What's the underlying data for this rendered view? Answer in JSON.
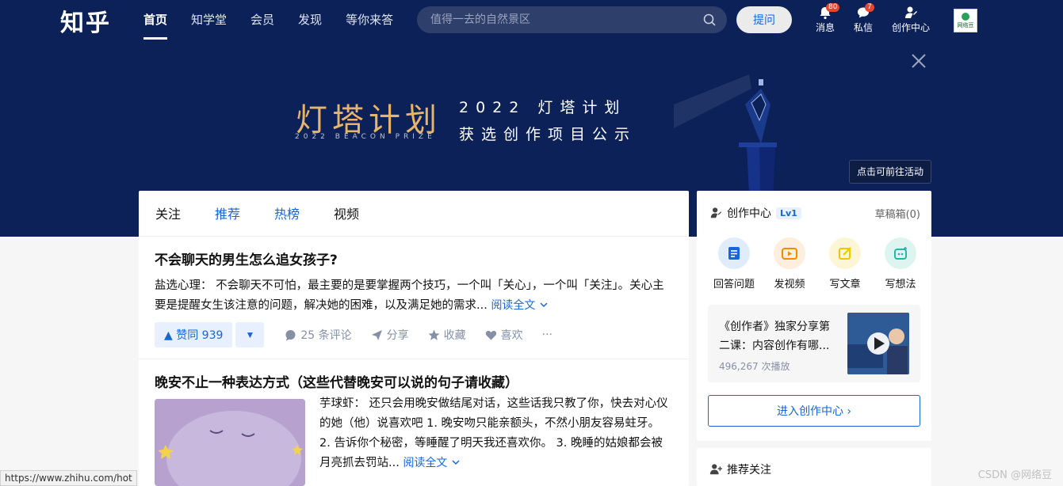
{
  "header": {
    "logo": "知乎",
    "nav": [
      "首页",
      "知学堂",
      "会员",
      "发现",
      "等你来答"
    ],
    "search_placeholder": "值得一去的自然景区",
    "ask_label": "提问",
    "icons": [
      {
        "label": "消息",
        "badge": "80",
        "icon": "bell-icon"
      },
      {
        "label": "私信",
        "badge": "7",
        "icon": "chat-bubble-icon"
      },
      {
        "label": "创作中心",
        "badge": "",
        "icon": "creator-icon"
      }
    ],
    "avatar_text": "网络豆"
  },
  "banner": {
    "title": "灯塔计划",
    "subtitle_en": "2022 BEACON PRIZE",
    "line1": "2022 灯塔计划",
    "line2": "获选创作项目公示",
    "cta": "点击可前往活动"
  },
  "feed": {
    "tabs": [
      "关注",
      "推荐",
      "热榜",
      "视频"
    ],
    "cards": [
      {
        "title": "不会聊天的男生怎么追女孩子?",
        "excerpt": "盐选心理： 不会聊天不可怕，最主要的是要掌握两个技巧，一个叫「关心」，一个叫「关注」。关心主要是提醒女生该注意的问题，解决她的困难，以及满足她的需求...",
        "read_more": "阅读全文",
        "vote_up": "▲ 赞同 939",
        "vote_down": "▼",
        "comments": "25 条评论",
        "share": "分享",
        "collect": "收藏",
        "like": "喜欢",
        "more": "···"
      },
      {
        "title": "晚安不止一种表达方式（这些代替晚安可以说的句子请收藏）",
        "excerpt": "芋球虾： 还只会用晚安做结尾对话，这些话我只教了你，快去对心仪的她（他）说喜欢吧 1. 晚安吻只能亲额头，不然小朋友容易蛀牙。 2. 告诉你个秘密，等睡醒了明天我还喜欢你。 3. 晚睡的姑娘都会被月亮抓去罚站...",
        "read_more": "阅读全文"
      }
    ]
  },
  "sidebar": {
    "creator_title": "创作中心",
    "level": "Lv1",
    "drafts": "草稿箱(0)",
    "tools": [
      {
        "label": "回答问题",
        "icon": "answer-icon",
        "color": "#1766d7"
      },
      {
        "label": "发视频",
        "icon": "video-icon",
        "color": "#f38a00"
      },
      {
        "label": "写文章",
        "icon": "write-icon",
        "color": "#f5c400"
      },
      {
        "label": "写想法",
        "icon": "idea-icon",
        "color": "#21b8a8"
      }
    ],
    "promo_text": "《创作者》独家分享第二课：内容创作有哪...",
    "promo_views": "496,267 次播放",
    "enter_label": "进入创作中心 ›",
    "recommend_title": "推荐关注"
  },
  "status_url": "https://www.zhihu.com/hot",
  "watermark": "CSDN @网络豆"
}
